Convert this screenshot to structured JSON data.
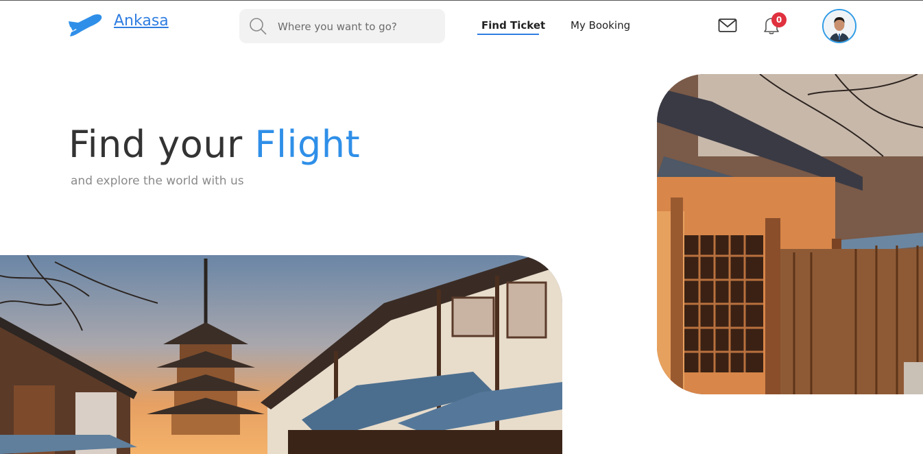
{
  "header": {
    "brand": "Ankasa",
    "logo_icon": "plane-icon",
    "search": {
      "placeholder": "Where you want to go?",
      "value": "",
      "icon": "search-icon"
    },
    "nav": [
      {
        "label": "Find Ticket",
        "active": true
      },
      {
        "label": "My Booking",
        "active": false
      }
    ],
    "mail_icon": "envelope-icon",
    "notifications": {
      "icon": "bell-icon",
      "count": "0"
    },
    "avatar_icon": "user-avatar"
  },
  "hero": {
    "title_plain": "Find your",
    "title_accent": "Flight",
    "subtitle": "and explore the world with us"
  },
  "colors": {
    "accent": "#2f8fe8",
    "badge": "#e0313e",
    "title": "#333333",
    "subtitle": "#8a8a8a"
  },
  "images": {
    "left": "kyoto-street-pagoda-photo",
    "right": "wooden-japanese-house-photo"
  }
}
